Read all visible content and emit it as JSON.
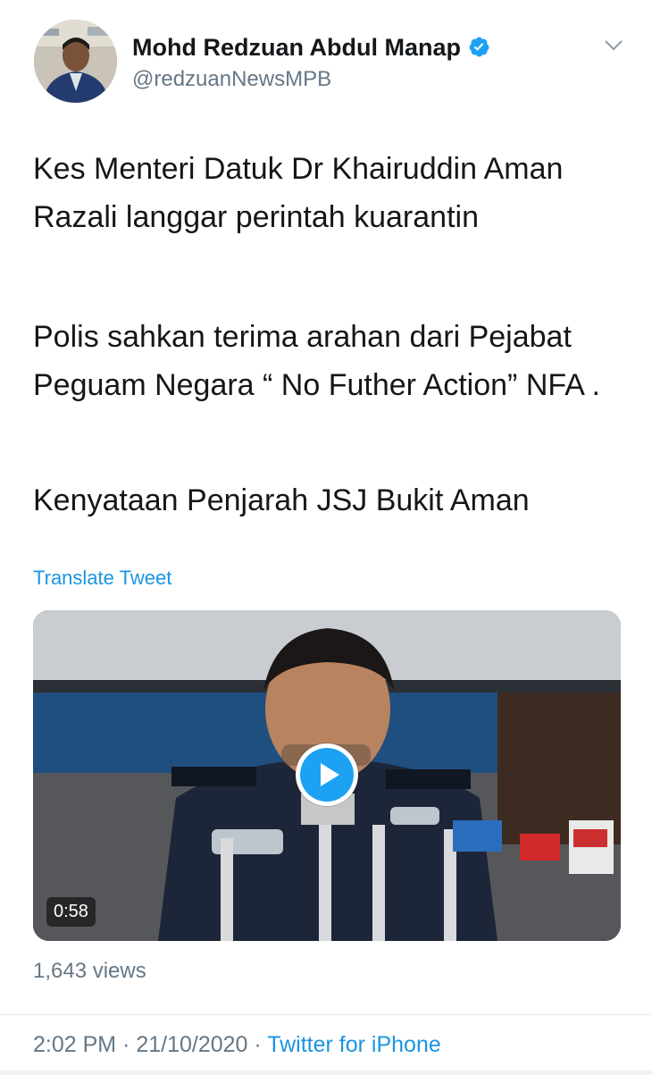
{
  "header": {
    "display_name": "Mohd Redzuan Abdul Manap",
    "handle": "@redzuanNewsMPB",
    "verified": true,
    "icons": [
      "avatar-photo",
      "verified-badge-icon",
      "chevron-down-icon"
    ]
  },
  "tweet": {
    "paragraphs": [
      "Kes Menteri Datuk Dr Khairuddin Aman Razali langgar perintah kuarantin",
      "Polis sahkan terima arahan dari Pejabat Peguam Negara “ No Futher Action” NFA .",
      "Kenyataan Penjarah JSJ Bukit Aman"
    ],
    "translate_label": "Translate Tweet"
  },
  "video": {
    "duration": "0:58",
    "views": "1,643 views"
  },
  "meta": {
    "time": "2:02 PM",
    "separator": " · ",
    "date": "21/10/2020",
    "source": "Twitter for iPhone"
  },
  "colors": {
    "link": "#1b95e0",
    "muted": "#657786",
    "text": "#14171a"
  }
}
